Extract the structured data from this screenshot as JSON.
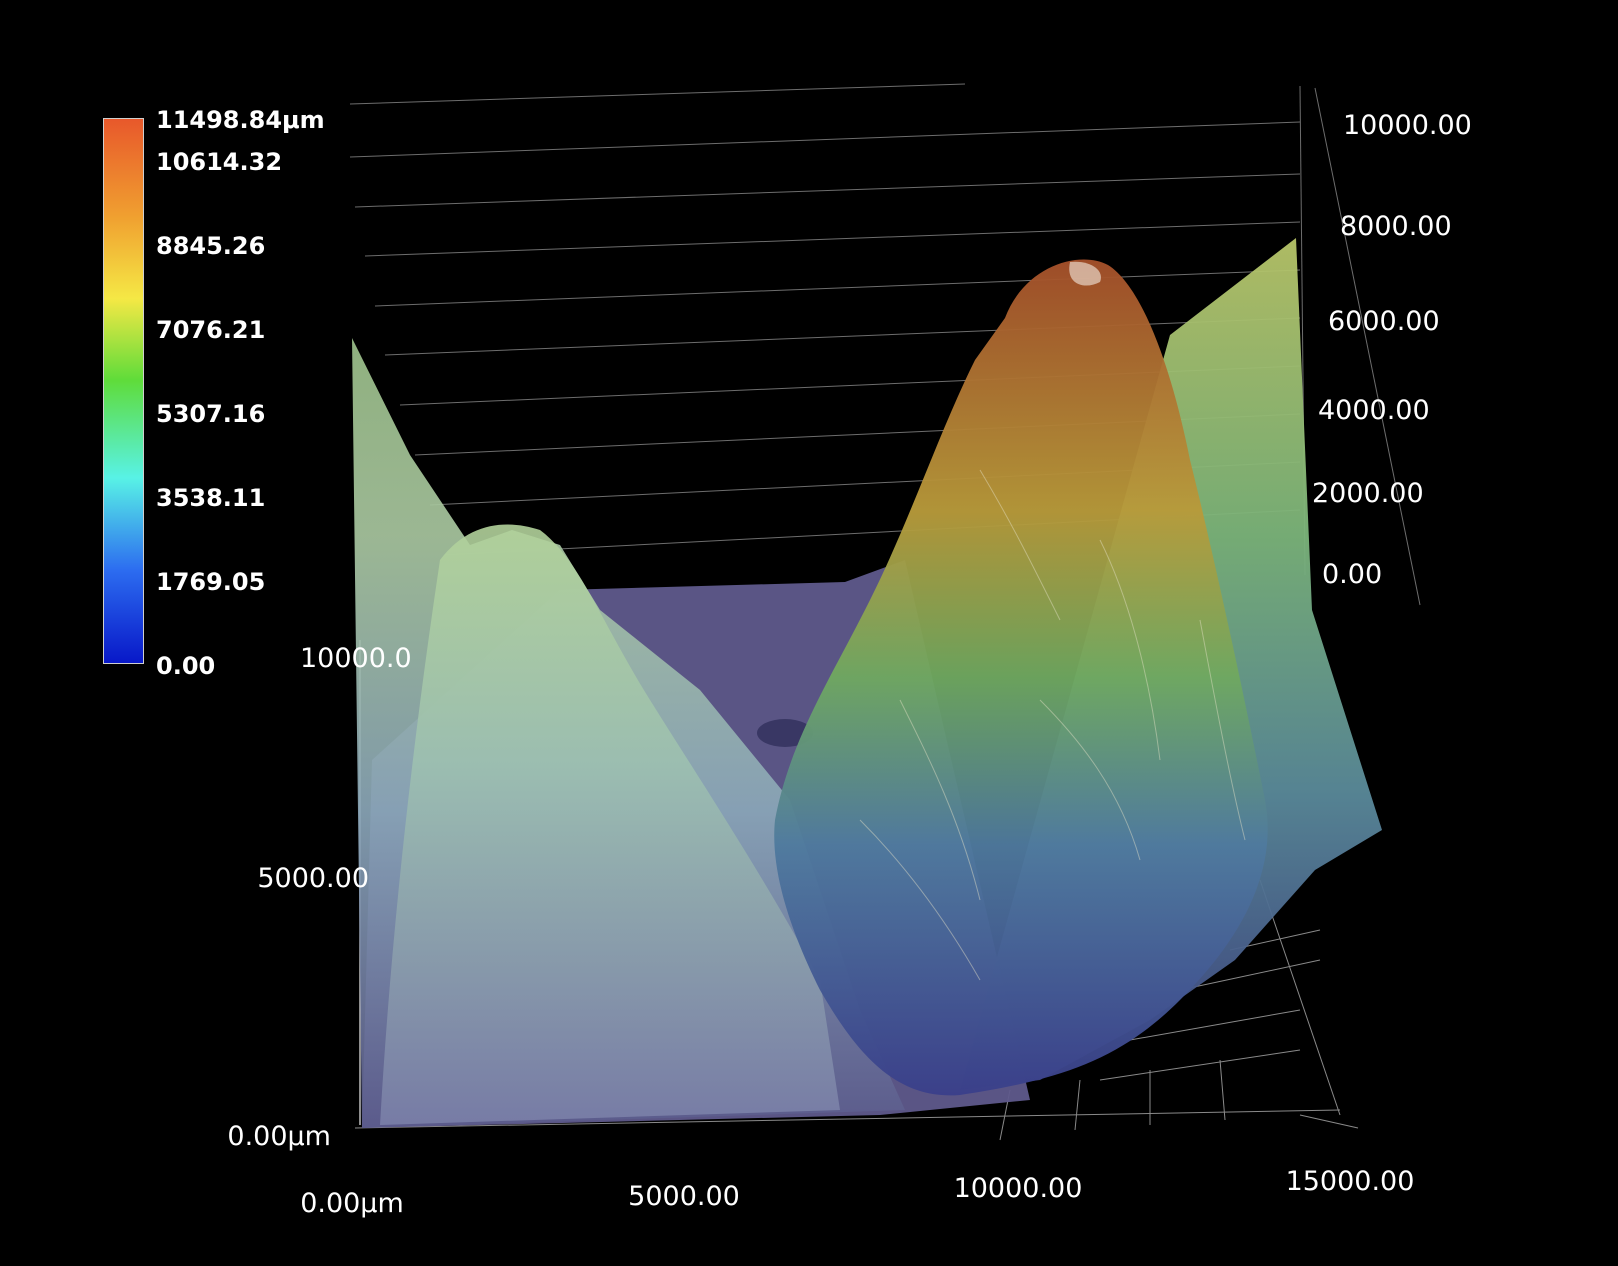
{
  "colorbar": {
    "labels": [
      "11498.84μm",
      "10614.32",
      "8845.26",
      "7076.21",
      "5307.16",
      "3538.11",
      "1769.05",
      "0.00"
    ],
    "colors": [
      "#e8582b",
      "#f0d040",
      "#5fdc3a",
      "#58f2e6",
      "#2c6cf0",
      "#0818c8"
    ]
  },
  "axes": {
    "x": {
      "ticks": [
        "0.00μm",
        "5000.00",
        "10000.00",
        "15000.00"
      ]
    },
    "y": {
      "ticks": [
        "0.00μm",
        "5000.00",
        "10000.0"
      ]
    },
    "z": {
      "ticks": [
        "10000.00",
        "8000.00",
        "6000.00",
        "4000.00",
        "2000.00",
        "0.00"
      ]
    }
  }
}
